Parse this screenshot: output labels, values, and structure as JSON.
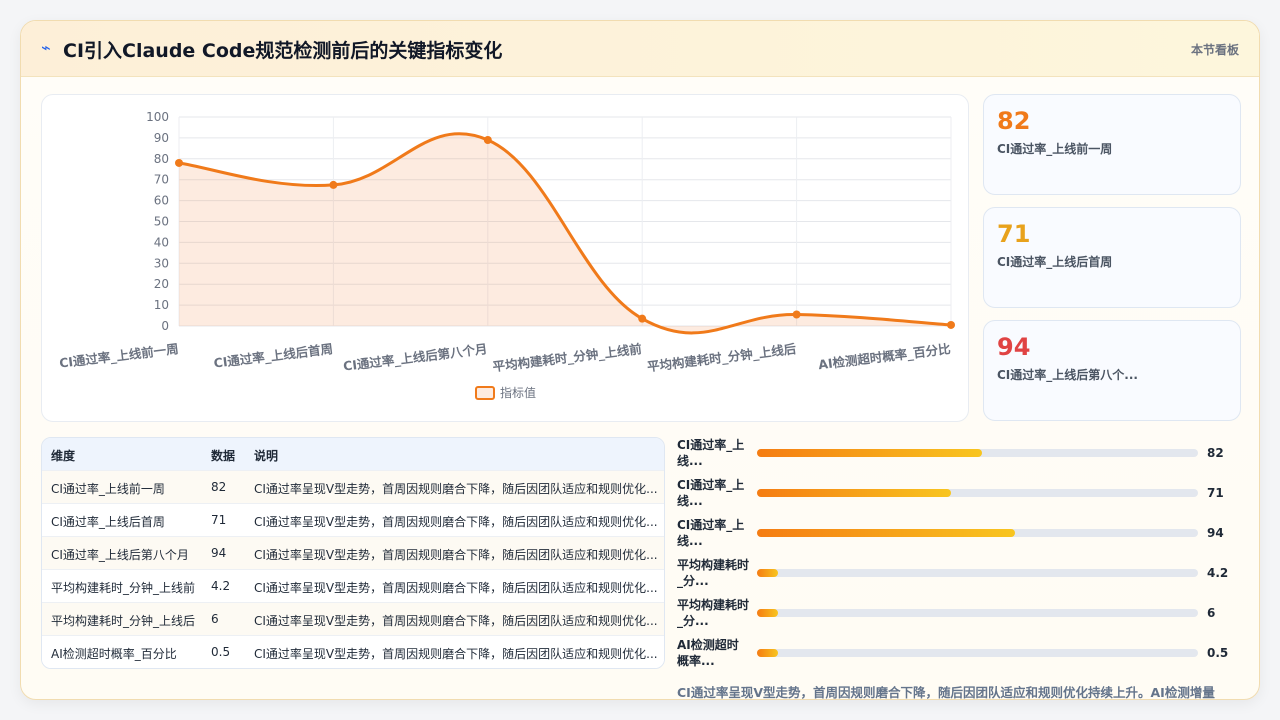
{
  "header": {
    "icon": "pulse-icon",
    "title": "CI引入Claude Code规范检测前后的关键指标变化",
    "board_link": "本节看板"
  },
  "colors": {
    "accent": "#f07a1a",
    "kpi1": "#f07a1a",
    "kpi2": "#e8a21c",
    "kpi3": "#e04343"
  },
  "chart_data": {
    "type": "line",
    "categories": [
      "CI通过率_上线前一周",
      "CI通过率_上线后首周",
      "CI通过率_上线后第八个月",
      "平均构建耗时_分钟_上线前",
      "平均构建耗时_分钟_上线后",
      "AI检测超时概率_百分比"
    ],
    "series": [
      {
        "name": "指标值",
        "values": [
          78,
          67.5,
          89,
          3.5,
          5.5,
          0.5
        ],
        "color": "#f07a1a"
      }
    ],
    "ylim": [
      0,
      100
    ],
    "yticks": [
      "0",
      "10",
      "20",
      "30",
      "40",
      "50",
      "60",
      "70",
      "80",
      "90",
      "100"
    ],
    "grid": true,
    "legend": "bottom"
  },
  "kpis": [
    {
      "value": "82",
      "label": "CI通过率_上线前一周"
    },
    {
      "value": "71",
      "label": "CI通过率_上线后首周"
    },
    {
      "value": "94",
      "label": "CI通过率_上线后第八个..."
    }
  ],
  "table": {
    "headers": [
      "维度",
      "数据",
      "说明"
    ],
    "rows": [
      [
        "CI通过率_上线前一周",
        "82",
        "CI通过率呈现V型走势，首周因规则磨合下降，随后因团队适应和规则优化..."
      ],
      [
        "CI通过率_上线后首周",
        "71",
        "CI通过率呈现V型走势，首周因规则磨合下降，随后因团队适应和规则优化..."
      ],
      [
        "CI通过率_上线后第八个月",
        "94",
        "CI通过率呈现V型走势，首周因规则磨合下降，随后因团队适应和规则优化..."
      ],
      [
        "平均构建耗时_分钟_上线前",
        "4.2",
        "CI通过率呈现V型走势，首周因规则磨合下降，随后因团队适应和规则优化..."
      ],
      [
        "平均构建耗时_分钟_上线后",
        "6",
        "CI通过率呈现V型走势，首周因规则磨合下降，随后因团队适应和规则优化..."
      ],
      [
        "AI检测超时概率_百分比",
        "0.5",
        "CI通过率呈现V型走势，首周因规则磨合下降，随后因团队适应和规则优化..."
      ]
    ]
  },
  "bars": [
    {
      "label": "CI通过率_上\n线...",
      "value": "82",
      "fraction": 0.51
    },
    {
      "label": "CI通过率_上\n线...",
      "value": "71",
      "fraction": 0.44
    },
    {
      "label": "CI通过率_上\n线...",
      "value": "94",
      "fraction": 0.585
    },
    {
      "label": "平均构建耗时\n_分...",
      "value": "4.2",
      "fraction": 0.048
    },
    {
      "label": "平均构建耗时\n_分...",
      "value": "6",
      "fraction": 0.048
    },
    {
      "label": "AI检测超时\n概率...",
      "value": "0.5",
      "fraction": 0.048
    }
  ],
  "summary": "CI通过率呈现V型走势，首周因规则磨合下降，随后因团队适应和规则优化持续上升。AI检测增量"
}
